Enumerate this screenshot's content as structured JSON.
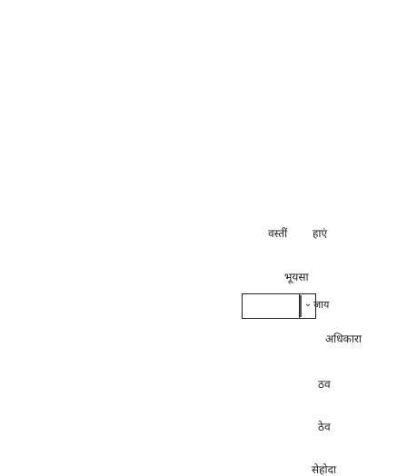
{
  "labels": {
    "a": "वस्तीं",
    "b": "हाएं",
    "c": "भूयसा",
    "d": "अधिकारा",
    "e": "ठव",
    "f": "ठेव",
    "g": "सेहोदा"
  },
  "select": {
    "value": "जाय"
  },
  "icons": {
    "chevron": "chevron-down-icon"
  }
}
